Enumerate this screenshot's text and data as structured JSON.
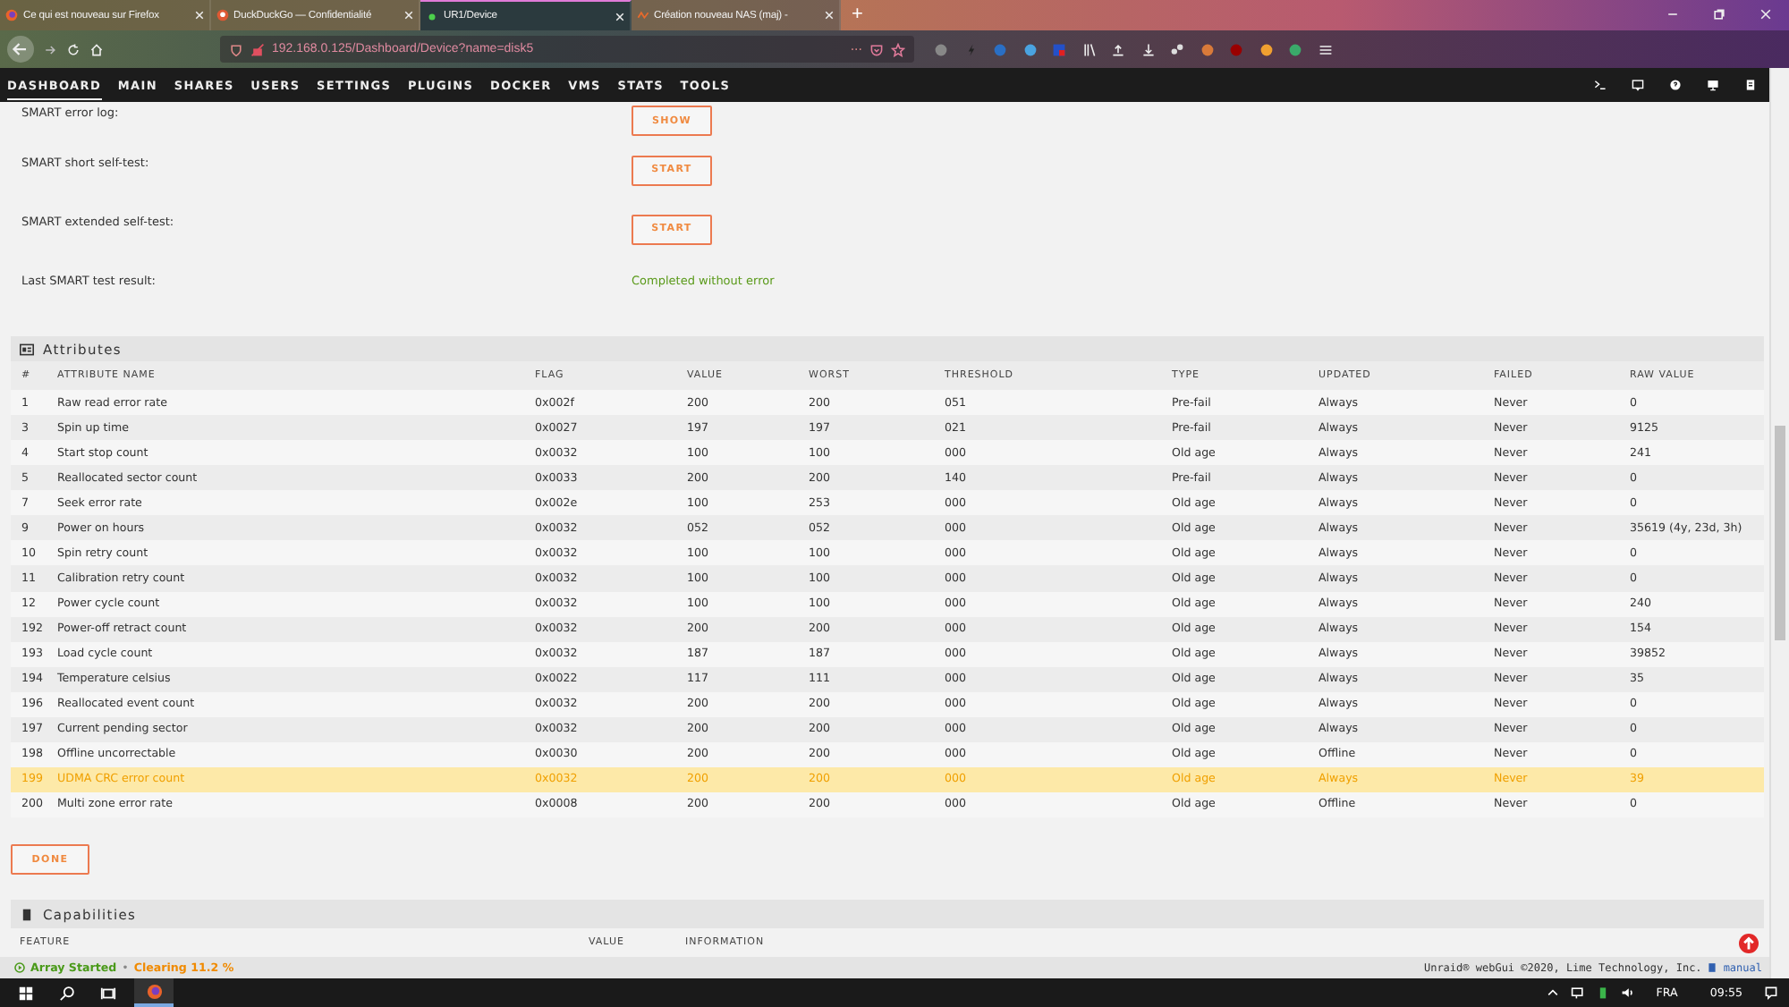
{
  "browser": {
    "tabs": [
      {
        "title": "Ce qui est nouveau sur Firefox",
        "selected": false,
        "kind": "firefox"
      },
      {
        "title": "DuckDuckGo — Confidentialité",
        "selected": false,
        "kind": "duck"
      },
      {
        "title": "UR1/Device",
        "selected": true,
        "kind": "dot"
      },
      {
        "title": "Création nouveau NAS (maj) -",
        "selected": false,
        "kind": "wave"
      }
    ],
    "new_tab": "+",
    "address": "192.168.0.125/Dashboard/Device?name=disk5",
    "more": "···"
  },
  "nav": {
    "items": [
      {
        "label": "DASHBOARD",
        "selected": true
      },
      {
        "label": "MAIN",
        "selected": false
      },
      {
        "label": "SHARES",
        "selected": false
      },
      {
        "label": "USERS",
        "selected": false
      },
      {
        "label": "SETTINGS",
        "selected": false
      },
      {
        "label": "PLUGINS",
        "selected": false
      },
      {
        "label": "DOCKER",
        "selected": false
      },
      {
        "label": "VMS",
        "selected": false
      },
      {
        "label": "STATS",
        "selected": false
      },
      {
        "label": "TOOLS",
        "selected": false
      }
    ]
  },
  "smart": [
    {
      "label": "SMART error log:",
      "kind": "button",
      "value": "SHOW"
    },
    {
      "label": "SMART short self-test:",
      "kind": "button",
      "value": "START"
    },
    {
      "label": "SMART extended self-test:",
      "kind": "button",
      "value": "START"
    },
    {
      "label": "Last SMART test result:",
      "kind": "status",
      "value": "Completed without error"
    }
  ],
  "attributes": {
    "title": "Attributes",
    "columns": [
      "#",
      "ATTRIBUTE NAME",
      "FLAG",
      "VALUE",
      "WORST",
      "THRESHOLD",
      "TYPE",
      "UPDATED",
      "FAILED",
      "RAW VALUE"
    ],
    "rows": [
      {
        "cells": [
          "1",
          "Raw read error rate",
          "0x002f",
          "200",
          "200",
          "051",
          "Pre-fail",
          "Always",
          "Never",
          "0"
        ],
        "warning": false
      },
      {
        "cells": [
          "3",
          "Spin up time",
          "0x0027",
          "197",
          "197",
          "021",
          "Pre-fail",
          "Always",
          "Never",
          "9125"
        ],
        "warning": false
      },
      {
        "cells": [
          "4",
          "Start stop count",
          "0x0032",
          "100",
          "100",
          "000",
          "Old age",
          "Always",
          "Never",
          "241"
        ],
        "warning": false
      },
      {
        "cells": [
          "5",
          "Reallocated sector count",
          "0x0033",
          "200",
          "200",
          "140",
          "Pre-fail",
          "Always",
          "Never",
          "0"
        ],
        "warning": false
      },
      {
        "cells": [
          "7",
          "Seek error rate",
          "0x002e",
          "100",
          "253",
          "000",
          "Old age",
          "Always",
          "Never",
          "0"
        ],
        "warning": false
      },
      {
        "cells": [
          "9",
          "Power on hours",
          "0x0032",
          "052",
          "052",
          "000",
          "Old age",
          "Always",
          "Never",
          "35619 (4y, 23d, 3h)"
        ],
        "warning": false
      },
      {
        "cells": [
          "10",
          "Spin retry count",
          "0x0032",
          "100",
          "100",
          "000",
          "Old age",
          "Always",
          "Never",
          "0"
        ],
        "warning": false
      },
      {
        "cells": [
          "11",
          "Calibration retry count",
          "0x0032",
          "100",
          "100",
          "000",
          "Old age",
          "Always",
          "Never",
          "0"
        ],
        "warning": false
      },
      {
        "cells": [
          "12",
          "Power cycle count",
          "0x0032",
          "100",
          "100",
          "000",
          "Old age",
          "Always",
          "Never",
          "240"
        ],
        "warning": false
      },
      {
        "cells": [
          "192",
          "Power-off retract count",
          "0x0032",
          "200",
          "200",
          "000",
          "Old age",
          "Always",
          "Never",
          "154"
        ],
        "warning": false
      },
      {
        "cells": [
          "193",
          "Load cycle count",
          "0x0032",
          "187",
          "187",
          "000",
          "Old age",
          "Always",
          "Never",
          "39852"
        ],
        "warning": false
      },
      {
        "cells": [
          "194",
          "Temperature celsius",
          "0x0022",
          "117",
          "111",
          "000",
          "Old age",
          "Always",
          "Never",
          "35"
        ],
        "warning": false
      },
      {
        "cells": [
          "196",
          "Reallocated event count",
          "0x0032",
          "200",
          "200",
          "000",
          "Old age",
          "Always",
          "Never",
          "0"
        ],
        "warning": false
      },
      {
        "cells": [
          "197",
          "Current pending sector",
          "0x0032",
          "200",
          "200",
          "000",
          "Old age",
          "Always",
          "Never",
          "0"
        ],
        "warning": false
      },
      {
        "cells": [
          "198",
          "Offline uncorrectable",
          "0x0030",
          "200",
          "200",
          "000",
          "Old age",
          "Offline",
          "Never",
          "0"
        ],
        "warning": false
      },
      {
        "cells": [
          "199",
          "UDMA CRC error count",
          "0x0032",
          "200",
          "200",
          "000",
          "Old age",
          "Always",
          "Never",
          "39"
        ],
        "warning": true
      },
      {
        "cells": [
          "200",
          "Multi zone error rate",
          "0x0008",
          "200",
          "200",
          "000",
          "Old age",
          "Offline",
          "Never",
          "0"
        ],
        "warning": false
      }
    ]
  },
  "done_button": "DONE",
  "capabilities": {
    "title": "Capabilities",
    "columns": [
      "FEATURE",
      "VALUE",
      "INFORMATION"
    ]
  },
  "status_bar": {
    "array": "Array Started",
    "separator": "•",
    "activity": "Clearing 11.2 %",
    "footer": "Unraid® webGui ©2020, Lime Technology, Inc.",
    "manual": "manual"
  },
  "taskbar": {
    "language": "FRA",
    "time": "09:55"
  }
}
